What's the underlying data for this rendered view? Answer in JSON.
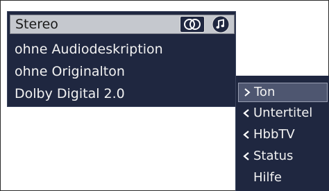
{
  "audio_panel": {
    "selected": "Stereo",
    "options": [
      "ohne Audiodeskription",
      "ohne Originalton",
      "Dolby Digital 2.0"
    ],
    "icons": [
      "stereo-rings-icon",
      "music-note-icon"
    ]
  },
  "menu": {
    "items": [
      {
        "label": "Ton",
        "icon": "chevron-right-icon"
      },
      {
        "label": "Untertitel",
        "icon": "chevron-left-icon"
      },
      {
        "label": "HbbTV",
        "icon": "chevron-left-icon"
      },
      {
        "label": "Status",
        "icon": "chevron-left-icon"
      },
      {
        "label": "Hilfe",
        "icon": ""
      }
    ]
  },
  "colors": {
    "panel_bg": "#1f2740",
    "selected_bg": "#c5c8ce",
    "menu_active_bg": "#4e5670",
    "text": "#f2f2f2"
  }
}
